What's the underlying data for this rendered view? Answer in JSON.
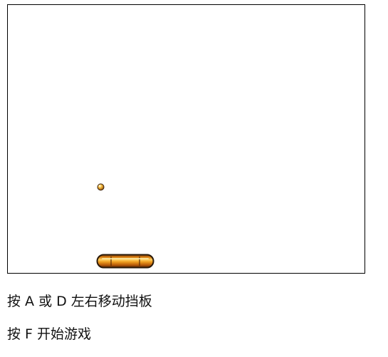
{
  "game": {
    "type": "breakout-paddle",
    "ball": {
      "color": "#e8a21e",
      "outline": "#3a2410"
    },
    "paddle": {
      "color": "#e08a10",
      "highlight": "#ffd060",
      "outline": "#2a1a0a"
    }
  },
  "instructions": {
    "move": "按 A 或 D 左右移动挡板",
    "start": "按 F 开始游戏"
  }
}
